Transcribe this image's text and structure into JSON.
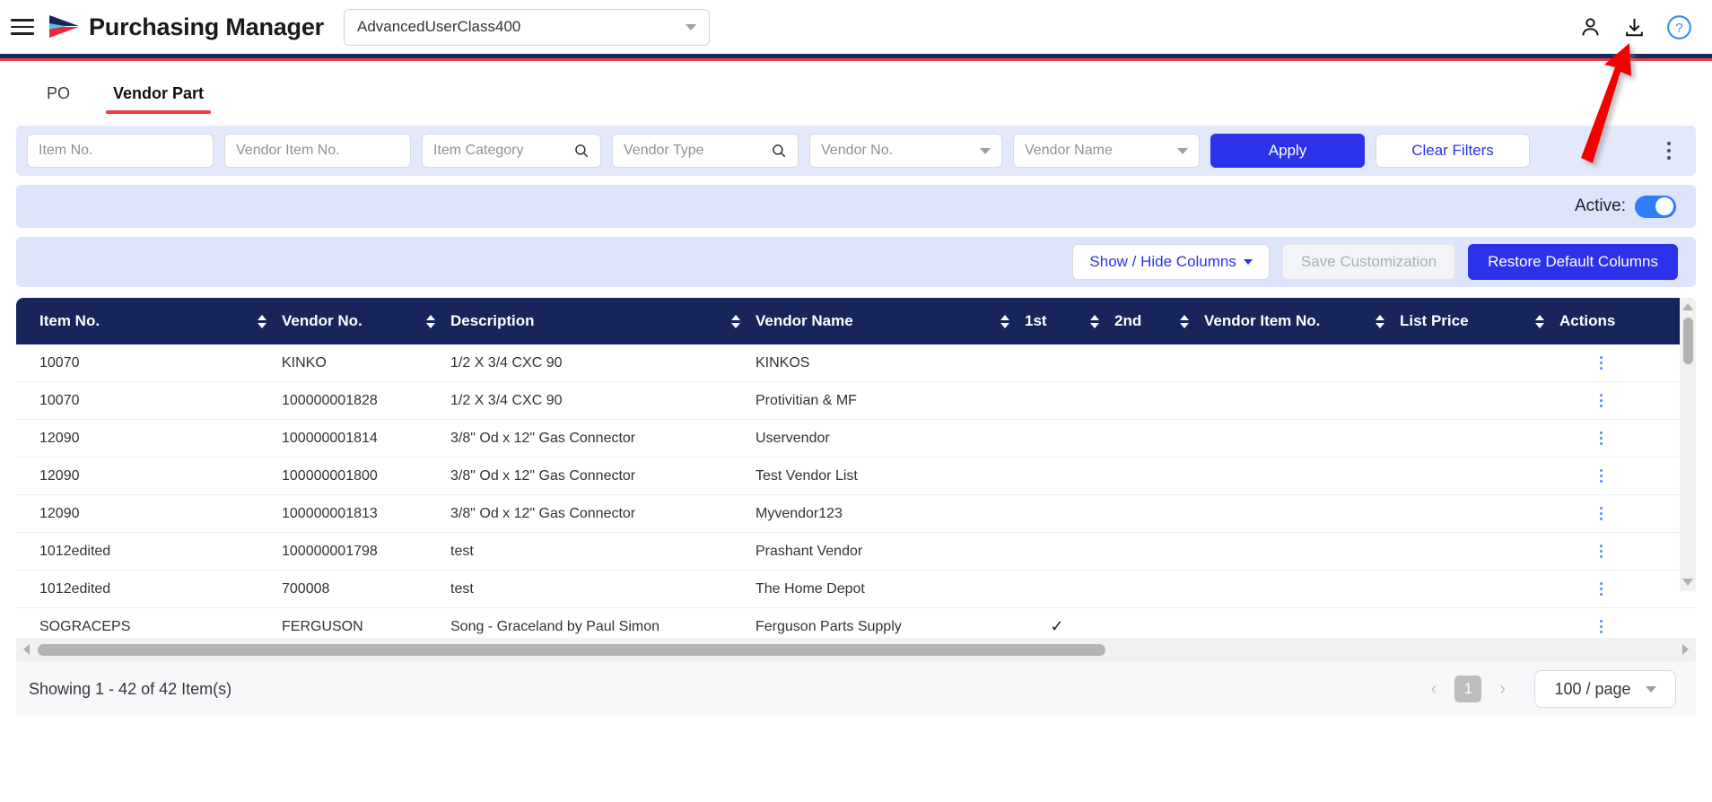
{
  "header": {
    "menu_icon": "hamburger-icon",
    "logo_icon": "arrow-logo",
    "app_title": "Purchasing Manager",
    "user_class_value": "AdvancedUserClass400",
    "icons": [
      {
        "name": "user-icon",
        "label": "User"
      },
      {
        "name": "download-icon",
        "label": "Download"
      },
      {
        "name": "help-icon",
        "label": "Help"
      }
    ],
    "colors": {
      "navy": "#17255a",
      "red": "#ef3b3b",
      "accent": "#2b32ea"
    }
  },
  "tabs": [
    {
      "label": "PO",
      "active": false
    },
    {
      "label": "Vendor Part",
      "active": true
    }
  ],
  "filters": {
    "fields": [
      {
        "name": "item-no-input",
        "placeholder": "Item No.",
        "value": "",
        "icon": "none"
      },
      {
        "name": "vendor-item-no-input",
        "placeholder": "Vendor Item No.",
        "value": "",
        "icon": "none"
      },
      {
        "name": "item-category-input",
        "placeholder": "Item Category",
        "value": "",
        "icon": "search-icon"
      },
      {
        "name": "vendor-type-input",
        "placeholder": "Vendor Type",
        "value": "",
        "icon": "search-icon"
      },
      {
        "name": "vendor-no-select",
        "placeholder": "Vendor No.",
        "value": "",
        "icon": "chevron-down-icon"
      },
      {
        "name": "vendor-name-select",
        "placeholder": "Vendor Name",
        "value": "",
        "icon": "chevron-down-icon"
      }
    ],
    "apply_label": "Apply",
    "clear_label": "Clear Filters",
    "overflow_icon": "kebab-menu-icon"
  },
  "active_bar": {
    "label": "Active:",
    "toggle_on": true
  },
  "columns_toolbar": {
    "show_hide_label": "Show / Hide Columns",
    "save_label": "Save Customization",
    "save_disabled": true,
    "restore_label": "Restore Default Columns"
  },
  "table": {
    "columns": [
      {
        "key": "item_no",
        "label": "Item No.",
        "sortable": true
      },
      {
        "key": "vendor_no",
        "label": "Vendor No.",
        "sortable": true
      },
      {
        "key": "description",
        "label": "Description",
        "sortable": true
      },
      {
        "key": "vendor_name",
        "label": "Vendor Name",
        "sortable": true
      },
      {
        "key": "first",
        "label": "1st",
        "sortable": true
      },
      {
        "key": "second",
        "label": "2nd",
        "sortable": true
      },
      {
        "key": "vendor_item_no",
        "label": "Vendor Item No.",
        "sortable": true
      },
      {
        "key": "list_price",
        "label": "List Price",
        "sortable": true
      },
      {
        "key": "actions",
        "label": "Actions",
        "sortable": false
      }
    ],
    "rows": [
      {
        "item_no": "10070",
        "vendor_no": "KINKO",
        "description": "1/2 X 3/4 CXC 90",
        "vendor_name": "KINKOS",
        "first": "",
        "second": "",
        "vendor_item_no": "",
        "list_price": ""
      },
      {
        "item_no": "10070",
        "vendor_no": "100000001828",
        "description": "1/2 X 3/4 CXC 90",
        "vendor_name": "Protivitian & MF",
        "first": "",
        "second": "",
        "vendor_item_no": "",
        "list_price": ""
      },
      {
        "item_no": "12090",
        "vendor_no": "100000001814",
        "description": "3/8\" Od x 12\" Gas Connector",
        "vendor_name": "Uservendor",
        "first": "",
        "second": "",
        "vendor_item_no": "",
        "list_price": ""
      },
      {
        "item_no": "12090",
        "vendor_no": "100000001800",
        "description": "3/8\" Od x 12\" Gas Connector",
        "vendor_name": "Test Vendor List",
        "first": "",
        "second": "",
        "vendor_item_no": "",
        "list_price": ""
      },
      {
        "item_no": "12090",
        "vendor_no": "100000001813",
        "description": "3/8\" Od x 12\" Gas Connector",
        "vendor_name": "Myvendor123",
        "first": "",
        "second": "",
        "vendor_item_no": "",
        "list_price": ""
      },
      {
        "item_no": "1012edited",
        "vendor_no": "100000001798",
        "description": "test",
        "vendor_name": "Prashant Vendor",
        "first": "",
        "second": "",
        "vendor_item_no": "",
        "list_price": ""
      },
      {
        "item_no": "1012edited",
        "vendor_no": "700008",
        "description": "test",
        "vendor_name": "The Home Depot",
        "first": "",
        "second": "",
        "vendor_item_no": "",
        "list_price": ""
      },
      {
        "item_no": "SOGRACEPS",
        "vendor_no": "FERGUSON",
        "description": "Song - Graceland by Paul Simon",
        "vendor_name": "Ferguson Parts Supply",
        "first": "✓",
        "second": "",
        "vendor_item_no": "",
        "list_price": ""
      }
    ],
    "row_action_icon": "kebab-menu-icon"
  },
  "footer": {
    "showing_text": "Showing 1 - 42 of 42 Item(s)",
    "prev_label": "‹",
    "page_label": "1",
    "next_label": "›",
    "per_page_label": "100 / page"
  },
  "annotation": {
    "arrow_color": "#f40000",
    "points_to": "download-icon"
  }
}
